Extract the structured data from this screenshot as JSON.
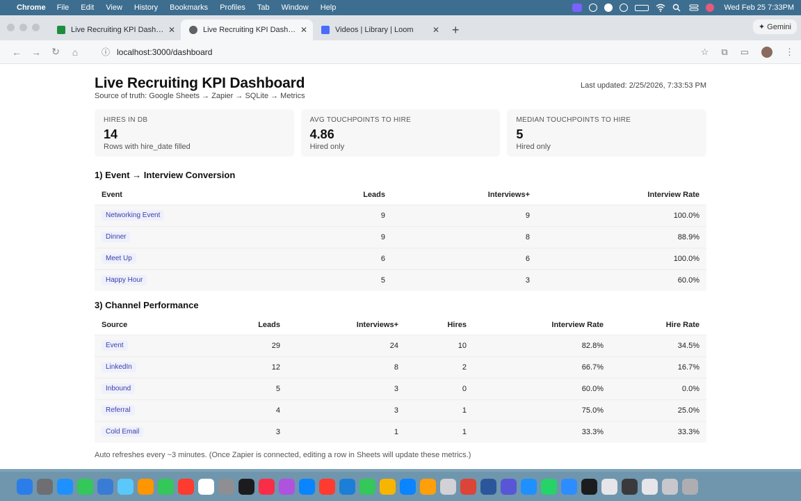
{
  "menubar": {
    "app": "Chrome",
    "items": [
      "File",
      "Edit",
      "View",
      "History",
      "Bookmarks",
      "Profiles",
      "Tab",
      "Window",
      "Help"
    ],
    "clock": "Wed Feb 25  7:33PM"
  },
  "browser": {
    "tabs": [
      {
        "title": "Live Recruiting KPI Dashboard",
        "favicon_color": "#1e8e3e"
      },
      {
        "title": "Live Recruiting KPI Dashboard",
        "favicon_color": "#5f6368"
      },
      {
        "title": "Videos | Library | Loom",
        "favicon_color": "#4b6bfb"
      }
    ],
    "gemini_label": "✦ Gemini",
    "url": "localhost:3000/dashboard"
  },
  "page": {
    "title": "Live Recruiting KPI Dashboard",
    "subtitle": "Source of truth: Google Sheets → Zapier → SQLite → Metrics",
    "last_updated": "Last updated: 2/25/2026, 7:33:53 PM",
    "cards": [
      {
        "label": "HIRES IN DB",
        "value": "14",
        "note": "Rows with hire_date filled"
      },
      {
        "label": "AVG TOUCHPOINTS TO HIRE",
        "value": "4.86",
        "note": "Hired only"
      },
      {
        "label": "MEDIAN TOUCHPOINTS TO HIRE",
        "value": "5",
        "note": "Hired only"
      }
    ],
    "event_section": {
      "heading": "1) Event → Interview Conversion",
      "columns": [
        "Event",
        "Leads",
        "Interviews+",
        "Interview Rate"
      ],
      "rows": [
        [
          "Networking Event",
          "9",
          "9",
          "100.0%"
        ],
        [
          "Dinner",
          "9",
          "8",
          "88.9%"
        ],
        [
          "Meet Up",
          "6",
          "6",
          "100.0%"
        ],
        [
          "Happy Hour",
          "5",
          "3",
          "60.0%"
        ]
      ]
    },
    "channel_section": {
      "heading": "3) Channel Performance",
      "columns": [
        "Source",
        "Leads",
        "Interviews+",
        "Hires",
        "Interview Rate",
        "Hire Rate"
      ],
      "rows": [
        [
          "Event",
          "29",
          "24",
          "10",
          "82.8%",
          "34.5%"
        ],
        [
          "LinkedIn",
          "12",
          "8",
          "2",
          "66.7%",
          "16.7%"
        ],
        [
          "Inbound",
          "5",
          "3",
          "0",
          "60.0%",
          "0.0%"
        ],
        [
          "Referral",
          "4",
          "3",
          "1",
          "75.0%",
          "25.0%"
        ],
        [
          "Cold Email",
          "3",
          "1",
          "1",
          "33.3%",
          "33.3%"
        ]
      ]
    },
    "footer": "Auto refreshes every ~3 minutes. (Once Zapier is connected, editing a row in Sheets will update these metrics.)"
  },
  "dock": {
    "icon_colors": [
      "#2b7de9",
      "#6e6e73",
      "#1e90ff",
      "#34c759",
      "#3a7bd5",
      "#5ac8fa",
      "#ff9500",
      "#34c759",
      "#ff3b30",
      "#ffffff",
      "#8e8e93",
      "#1c1c1e",
      "#fa2d48",
      "#af52de",
      "#0a84ff",
      "#ff3b30",
      "#1c7ed6",
      "#34c759",
      "#f7b500",
      "#0a84ff",
      "#ff9f0a",
      "#d1d1d6",
      "#db4437",
      "#2b579a",
      "#5856d6",
      "#1e90ff",
      "#25d366",
      "#2d8cff",
      "#1c1c1e",
      "#e5e5ea",
      "#3a3a3c",
      "#e5e5ea",
      "#c7c7cc",
      "#aeaeb2"
    ]
  }
}
